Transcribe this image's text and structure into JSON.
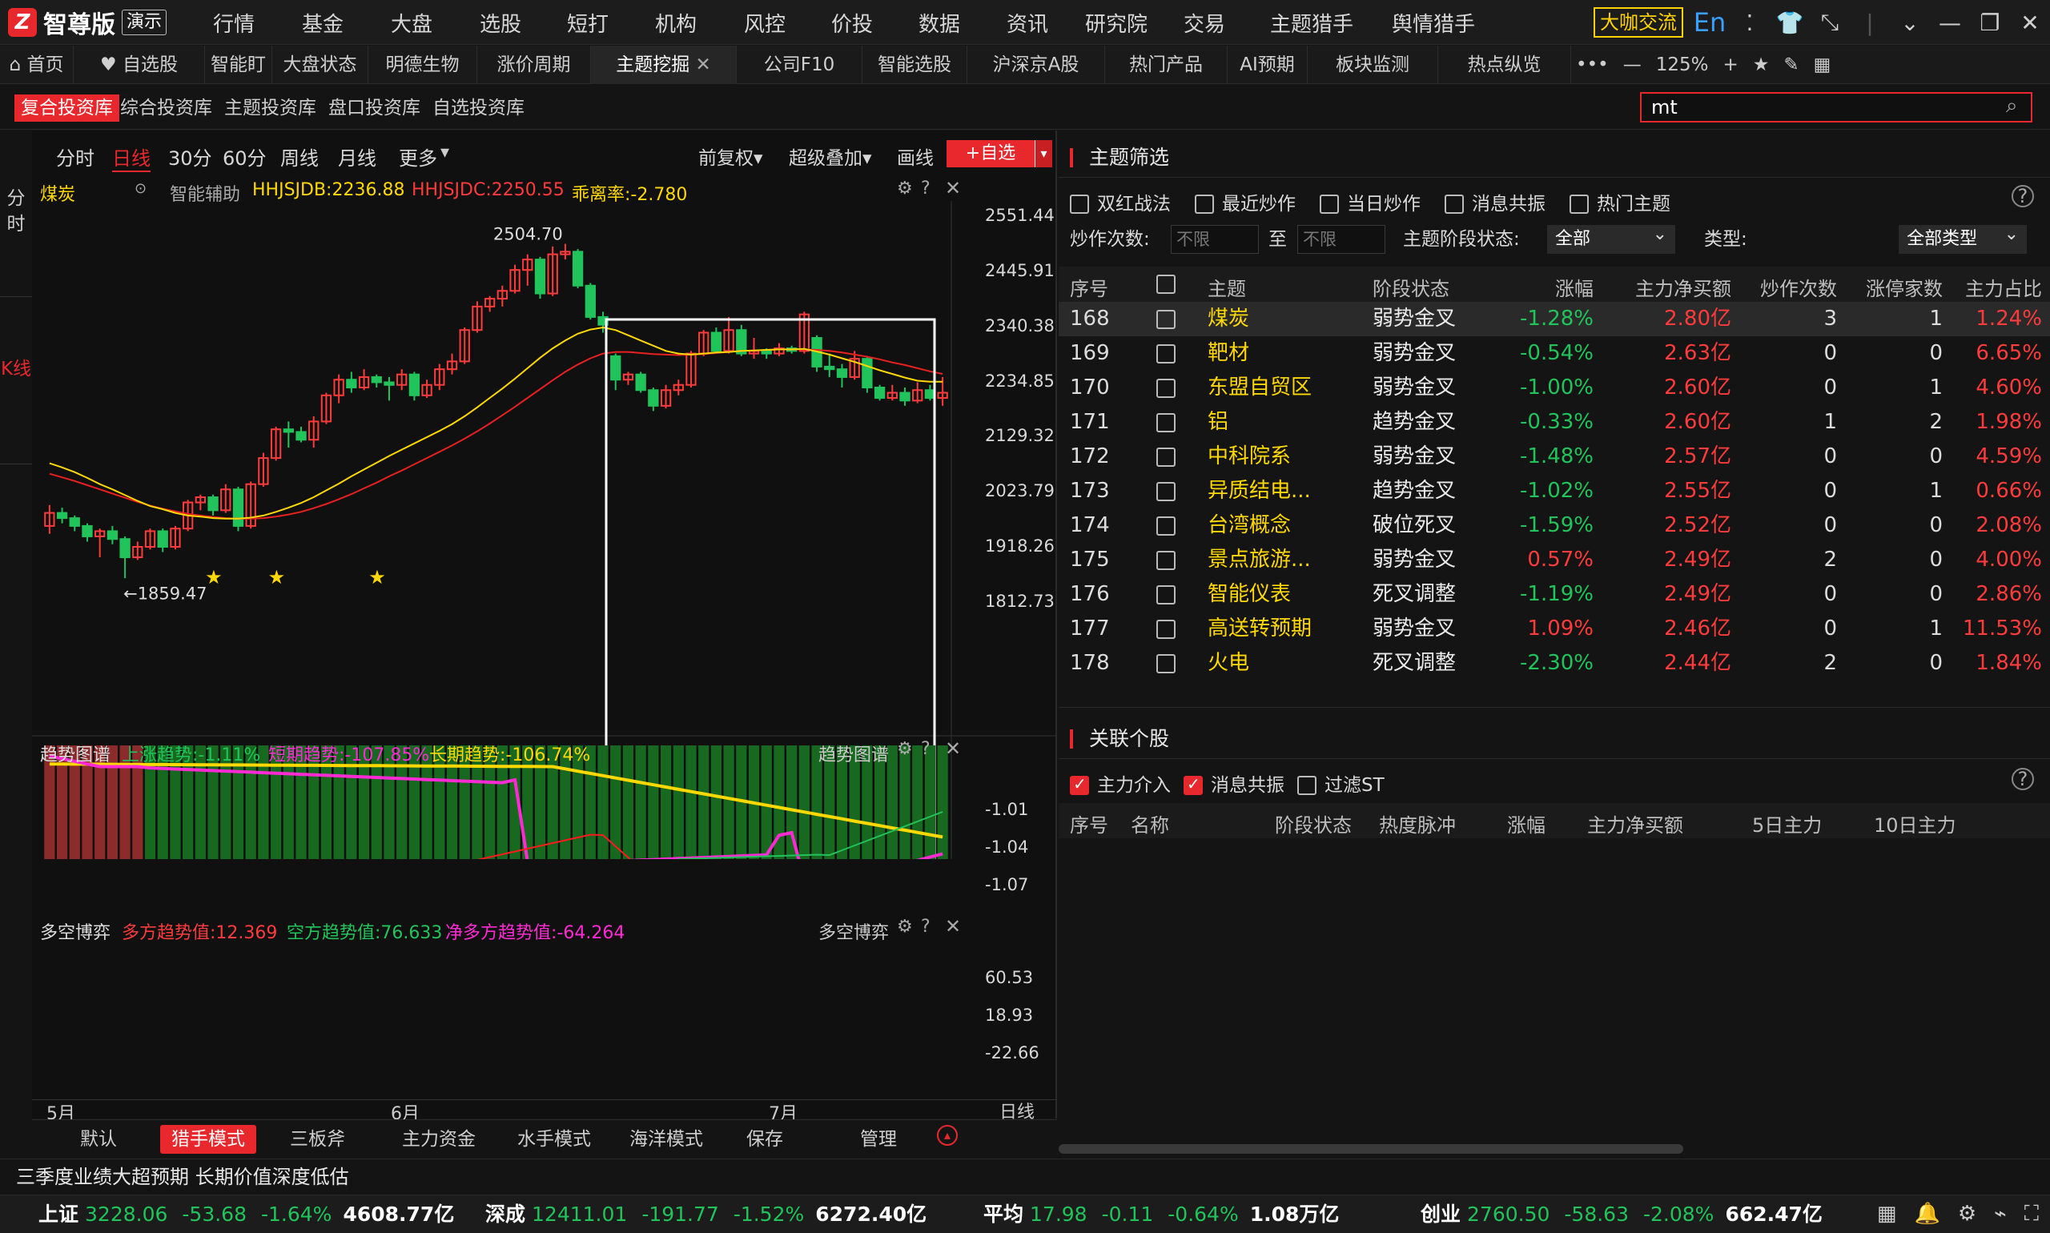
{
  "app": {
    "brand": "智尊版",
    "demo": "演示",
    "nav": [
      "行情",
      "基金",
      "大盘",
      "选股",
      "短打",
      "机构",
      "风控",
      "价投",
      "数据",
      "资讯",
      "研究院",
      "交易",
      "主题猎手",
      "舆情猎手"
    ],
    "right_btn": "大咖交流",
    "lang_icon": "En",
    "zoom": "125%"
  },
  "tabs": [
    "首页",
    "自选股",
    "智能盯盘",
    "大盘状态",
    "明德生物",
    "涨价周期",
    "主题挖掘",
    "公司F10",
    "智能选股",
    "沪深京A股",
    "热门产品",
    "AI预期",
    "板块监测",
    "热点纵览"
  ],
  "subnav": [
    "复合投资库",
    "综合投资库",
    "主题投资库",
    "盘口投资库",
    "自选投资库"
  ],
  "search": {
    "value": "mt"
  },
  "left_labels": {
    "minute": "分时",
    "kline": "K线"
  },
  "chart": {
    "periods": [
      "分时",
      "日线",
      "30分",
      "60分",
      "周线",
      "月线",
      "更多"
    ],
    "active_period": "日线",
    "tools": [
      "前复权",
      "超级叠加",
      "画线"
    ],
    "add_fav": "+自选",
    "stock_name": "煤炭",
    "aux_label": "智能辅助",
    "line1": "HHJSJDB:2236.88",
    "line2": "HHJSJDC:2250.55",
    "deviation": "乖离率:-2.780",
    "high_label": "2504.70",
    "low_label": "←1859.47",
    "price_axis": [
      "2551.44",
      "2445.91",
      "2340.38",
      "2234.85",
      "2129.32",
      "2023.79",
      "1918.26",
      "1812.73"
    ],
    "trend": {
      "title": "趋势图谱",
      "up": "上涨趋势:-1.11%",
      "short": "短期趋势:-107.85%",
      "long": "长期趋势:-106.74%",
      "axis": [
        "-1.01",
        "-1.04",
        "-1.07"
      ]
    },
    "longshort": {
      "title": "多空博弈",
      "long": "多方趋势值:12.369",
      "short": "空方趋势值:76.633",
      "net": "净多方趋势值:-64.264",
      "axis": [
        "60.53",
        "18.93",
        "-22.66"
      ]
    },
    "months": [
      "5月",
      "6月",
      "7月"
    ],
    "period_tag": "日线",
    "modes": [
      "默认",
      "猎手模式",
      "三板斧",
      "主力资金",
      "水手模式",
      "海洋模式",
      "保存",
      "管理"
    ],
    "active_mode": "猎手模式"
  },
  "chart_data": {
    "type": "candlestick",
    "ylim": [
      1812.73,
      2551.44
    ],
    "high": 2504.7,
    "low": 1859.47,
    "candles": [
      [
        1960,
        1985,
        1945,
        2000
      ],
      [
        1985,
        1975,
        1965,
        1995
      ],
      [
        1975,
        1960,
        1950,
        1980
      ],
      [
        1960,
        1940,
        1930,
        1965
      ],
      [
        1940,
        1950,
        1900,
        1955
      ],
      [
        1950,
        1935,
        1925,
        1960
      ],
      [
        1935,
        1900,
        1860,
        1940
      ],
      [
        1900,
        1920,
        1895,
        1930
      ],
      [
        1920,
        1950,
        1915,
        1955
      ],
      [
        1950,
        1920,
        1910,
        1955
      ],
      [
        1920,
        1955,
        1915,
        1960
      ],
      [
        1955,
        2005,
        1950,
        2010
      ],
      [
        2005,
        2015,
        1990,
        2020
      ],
      [
        2015,
        1990,
        1980,
        2020
      ],
      [
        1990,
        2030,
        1985,
        2040
      ],
      [
        2030,
        1960,
        1950,
        2035
      ],
      [
        1960,
        2040,
        1955,
        2045
      ],
      [
        2040,
        2090,
        2035,
        2100
      ],
      [
        2090,
        2145,
        2085,
        2150
      ],
      [
        2145,
        2140,
        2110,
        2160
      ],
      [
        2140,
        2125,
        2120,
        2150
      ],
      [
        2125,
        2160,
        2110,
        2170
      ],
      [
        2160,
        2210,
        2155,
        2215
      ],
      [
        2210,
        2240,
        2195,
        2250
      ],
      [
        2240,
        2225,
        2215,
        2255
      ],
      [
        2225,
        2245,
        2220,
        2260
      ],
      [
        2245,
        2235,
        2225,
        2250
      ],
      [
        2235,
        2230,
        2200,
        2245
      ],
      [
        2230,
        2250,
        2220,
        2260
      ],
      [
        2250,
        2210,
        2200,
        2255
      ],
      [
        2210,
        2230,
        2205,
        2240
      ],
      [
        2230,
        2260,
        2220,
        2270
      ],
      [
        2260,
        2275,
        2250,
        2290
      ],
      [
        2275,
        2335,
        2270,
        2340
      ],
      [
        2335,
        2380,
        2330,
        2390
      ],
      [
        2380,
        2395,
        2370,
        2400
      ],
      [
        2395,
        2410,
        2380,
        2420
      ],
      [
        2410,
        2450,
        2405,
        2460
      ],
      [
        2450,
        2470,
        2420,
        2480
      ],
      [
        2470,
        2405,
        2395,
        2475
      ],
      [
        2405,
        2480,
        2400,
        2495
      ],
      [
        2480,
        2485,
        2470,
        2500
      ],
      [
        2485,
        2420,
        2415,
        2490
      ],
      [
        2420,
        2360,
        2355,
        2425
      ],
      [
        2360,
        2345,
        2330,
        2370
      ],
      [
        2285,
        2240,
        2220,
        2290
      ],
      [
        2240,
        2250,
        2230,
        2255
      ],
      [
        2250,
        2220,
        2215,
        2255
      ],
      [
        2220,
        2190,
        2180,
        2225
      ],
      [
        2190,
        2220,
        2185,
        2230
      ],
      [
        2220,
        2230,
        2210,
        2240
      ],
      [
        2230,
        2290,
        2225,
        2295
      ],
      [
        2290,
        2330,
        2285,
        2335
      ],
      [
        2330,
        2295,
        2290,
        2340
      ],
      [
        2295,
        2335,
        2290,
        2360
      ],
      [
        2335,
        2290,
        2285,
        2345
      ],
      [
        2290,
        2295,
        2280,
        2320
      ],
      [
        2295,
        2290,
        2280,
        2300
      ],
      [
        2290,
        2300,
        2285,
        2310
      ],
      [
        2300,
        2295,
        2290,
        2305
      ],
      [
        2295,
        2365,
        2290,
        2370
      ],
      [
        2320,
        2265,
        2255,
        2325
      ],
      [
        2265,
        2260,
        2245,
        2290
      ],
      [
        2260,
        2245,
        2225,
        2270
      ],
      [
        2245,
        2280,
        2240,
        2295
      ],
      [
        2280,
        2225,
        2215,
        2285
      ],
      [
        2225,
        2205,
        2200,
        2230
      ],
      [
        2205,
        2215,
        2200,
        2230
      ],
      [
        2215,
        2200,
        2190,
        2225
      ],
      [
        2200,
        2220,
        2195,
        2235
      ],
      [
        2220,
        2205,
        2200,
        2230
      ],
      [
        2205,
        2215,
        2190,
        2245
      ]
    ],
    "ma_yellow": [
      2080,
      2072,
      2063,
      2052,
      2040,
      2030,
      2019,
      2008,
      1998,
      1992,
      1985,
      1980,
      1978,
      1975,
      1974,
      1974,
      1976,
      1980,
      1987,
      1995,
      2004,
      2015,
      2028,
      2041,
      2055,
      2068,
      2081,
      2094,
      2106,
      2118,
      2130,
      2142,
      2155,
      2170,
      2187,
      2205,
      2223,
      2242,
      2262,
      2282,
      2300,
      2315,
      2328,
      2336,
      2340,
      2335,
      2325,
      2315,
      2305,
      2295,
      2290,
      2288,
      2290,
      2292,
      2293,
      2295,
      2296,
      2297,
      2298,
      2298,
      2299,
      2294,
      2288,
      2281,
      2274,
      2266,
      2258,
      2251,
      2244,
      2238,
      2236,
      2236
    ],
    "ma_red": [
      2060,
      2053,
      2046,
      2038,
      2030,
      2022,
      2014,
      2006,
      1999,
      1993,
      1988,
      1983,
      1980,
      1977,
      1975,
      1974,
      1974,
      1975,
      1978,
      1982,
      1987,
      1994,
      2002,
      2011,
      2021,
      2032,
      2043,
      2055,
      2066,
      2078,
      2090,
      2102,
      2114,
      2127,
      2141,
      2156,
      2172,
      2188,
      2205,
      2222,
      2239,
      2255,
      2269,
      2281,
      2290,
      2293,
      2293,
      2291,
      2289,
      2288,
      2287,
      2288,
      2289,
      2291,
      2293,
      2295,
      2296,
      2297,
      2298,
      2298,
      2298,
      2297,
      2295,
      2292,
      2288,
      2284,
      2279,
      2273,
      2268,
      2262,
      2256,
      2251
    ]
  },
  "right": {
    "filter_title": "主题筛选",
    "checks": [
      "双红战法",
      "最近炒作",
      "当日炒作",
      "消息共振",
      "热门主题"
    ],
    "hype_label": "炒作次数:",
    "from_ph": "不限",
    "to_label": "至",
    "to_ph": "不限",
    "stage_label": "主题阶段状态:",
    "stage_val": "全部",
    "type_label": "类型:",
    "type_val": "全部类型",
    "headers": [
      "序号",
      "主题",
      "阶段状态",
      "涨幅",
      "主力净买额",
      "炒作次数",
      "涨停家数",
      "主力占比"
    ],
    "rows": [
      {
        "no": "168",
        "name": "煤炭",
        "stage": "弱势金叉",
        "chg": "-1.28%",
        "net": "2.80亿",
        "hype": "3",
        "limit": "1",
        "ratio": "1.24%"
      },
      {
        "no": "169",
        "name": "靶材",
        "stage": "弱势金叉",
        "chg": "-0.54%",
        "net": "2.63亿",
        "hype": "0",
        "limit": "0",
        "ratio": "6.65%"
      },
      {
        "no": "170",
        "name": "东盟自贸区",
        "stage": "弱势金叉",
        "chg": "-1.00%",
        "net": "2.60亿",
        "hype": "0",
        "limit": "1",
        "ratio": "4.60%"
      },
      {
        "no": "171",
        "name": "铝",
        "stage": "趋势金叉",
        "chg": "-0.33%",
        "net": "2.60亿",
        "hype": "1",
        "limit": "2",
        "ratio": "1.98%"
      },
      {
        "no": "172",
        "name": "中科院系",
        "stage": "弱势金叉",
        "chg": "-1.48%",
        "net": "2.57亿",
        "hype": "0",
        "limit": "0",
        "ratio": "4.59%"
      },
      {
        "no": "173",
        "name": "异质结电...",
        "stage": "趋势金叉",
        "chg": "-1.02%",
        "net": "2.55亿",
        "hype": "0",
        "limit": "1",
        "ratio": "0.66%"
      },
      {
        "no": "174",
        "name": "台湾概念",
        "stage": "破位死叉",
        "chg": "-1.59%",
        "net": "2.52亿",
        "hype": "0",
        "limit": "0",
        "ratio": "2.08%"
      },
      {
        "no": "175",
        "name": "景点旅游...",
        "stage": "弱势金叉",
        "chg": "0.57%",
        "net": "2.49亿",
        "hype": "2",
        "limit": "0",
        "ratio": "4.00%"
      },
      {
        "no": "176",
        "name": "智能仪表",
        "stage": "死叉调整",
        "chg": "-1.19%",
        "net": "2.49亿",
        "hype": "0",
        "limit": "0",
        "ratio": "2.86%"
      },
      {
        "no": "177",
        "name": "高送转预期",
        "stage": "弱势金叉",
        "chg": "1.09%",
        "net": "2.46亿",
        "hype": "0",
        "limit": "1",
        "ratio": "11.53%"
      },
      {
        "no": "178",
        "name": "火电",
        "stage": "死叉调整",
        "chg": "-2.30%",
        "net": "2.44亿",
        "hype": "2",
        "limit": "0",
        "ratio": "1.84%"
      }
    ],
    "related_title": "关联个股",
    "related_checks": [
      "主力介入",
      "消息共振",
      "过滤ST"
    ],
    "related_headers": [
      "序号",
      "名称",
      "阶段状态",
      "热度脉冲",
      "涨幅",
      "主力净买额",
      "5日主力",
      "10日主力"
    ]
  },
  "news": "三季度业绩大超预期 长期价值深度低估",
  "indices": [
    {
      "name": "上证",
      "val": "3228.06",
      "chg": "-53.68",
      "pct": "-1.64%",
      "amt": "4608.77亿"
    },
    {
      "name": "深成",
      "val": "12411.01",
      "chg": "-191.77",
      "pct": "-1.52%",
      "amt": "6272.40亿"
    },
    {
      "name": "平均",
      "val": "17.98",
      "chg": "-0.11",
      "pct": "-0.64%",
      "amt": "1.08万亿"
    },
    {
      "name": "创业",
      "val": "2760.50",
      "chg": "-58.63",
      "pct": "-2.08%",
      "amt": "662.47亿"
    }
  ],
  "colors": {
    "accent": "#e8282c",
    "up": "#ff3b3b",
    "down": "#21c45a",
    "ma1": "#ffd800",
    "ma2": "#e82020",
    "magenta": "#ff2ad4",
    "cyan": "#00e5ff"
  }
}
